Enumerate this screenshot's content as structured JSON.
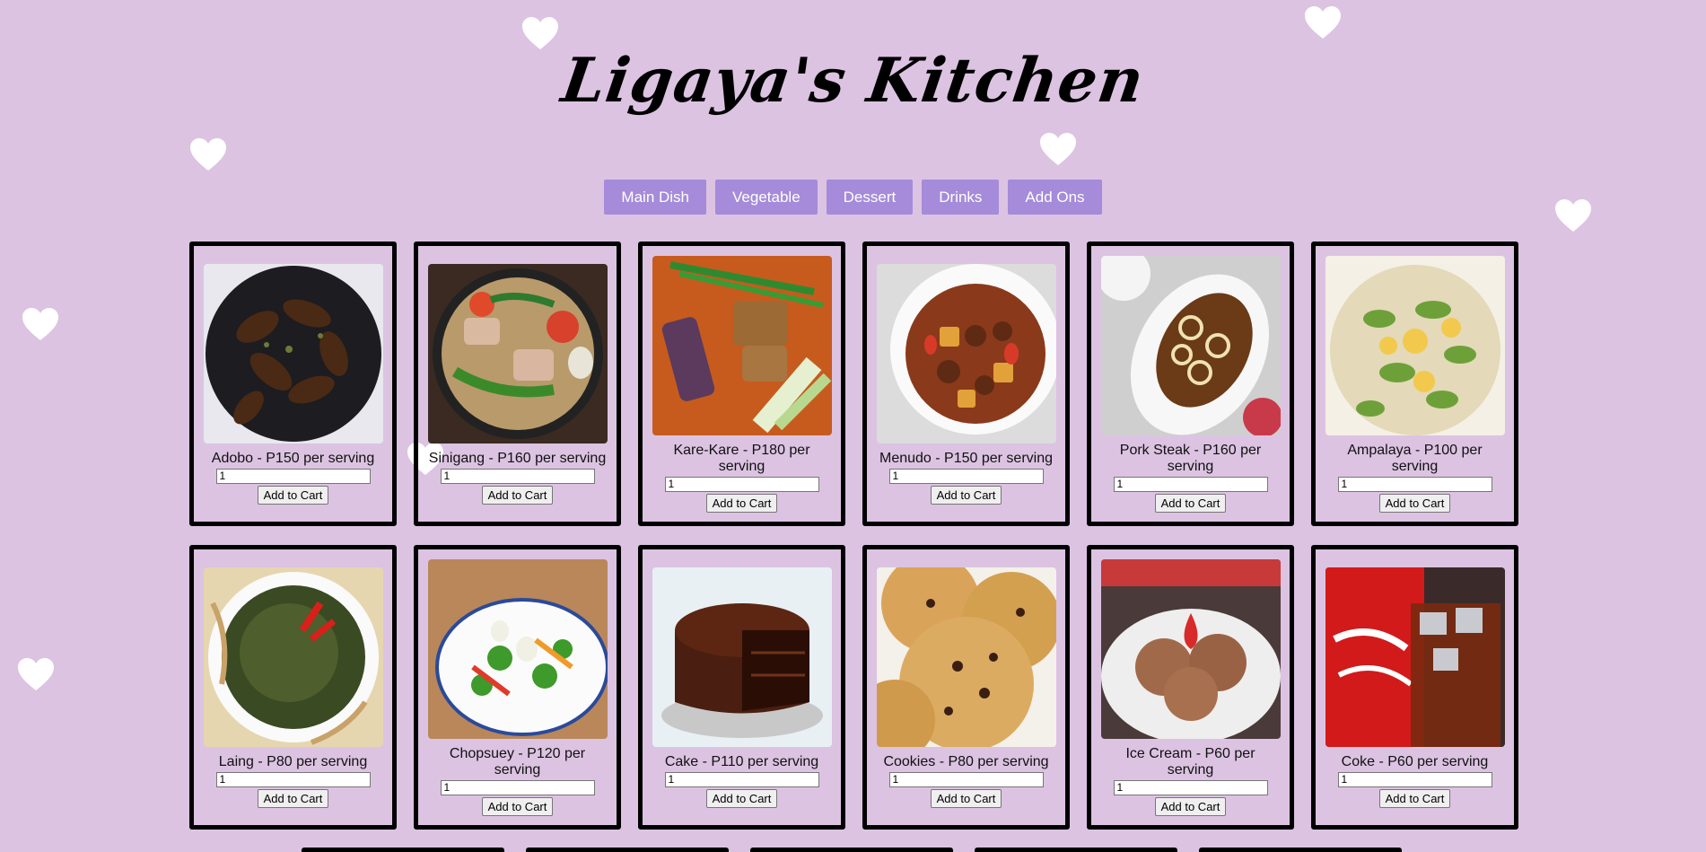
{
  "page": {
    "title": "Ligaya's Kitchen"
  },
  "nav": [
    {
      "label": "Main Dish"
    },
    {
      "label": "Vegetable"
    },
    {
      "label": "Dessert"
    },
    {
      "label": "Drinks"
    },
    {
      "label": "Add Ons"
    }
  ],
  "colors": {
    "background": "#dcc3e2",
    "nav_button": "#a58bd9",
    "card_border": "#000000",
    "heart": "#ffffff"
  },
  "menu": [
    {
      "name": "adobo",
      "label": "Adobo - P150 per serving",
      "qty": "1",
      "button": "Add to Cart",
      "image": "adobo-photo"
    },
    {
      "name": "sinigang",
      "label": "Sinigang - P160 per serving",
      "qty": "1",
      "button": "Add to Cart",
      "image": "sinigang-photo"
    },
    {
      "name": "kare-kare",
      "label": "Kare-Kare - P180 per serving",
      "qty": "1",
      "button": "Add to Cart",
      "image": "kare-kare-photo"
    },
    {
      "name": "menudo",
      "label": "Menudo - P150 per serving",
      "qty": "1",
      "button": "Add to Cart",
      "image": "menudo-photo"
    },
    {
      "name": "pork-steak",
      "label": "Pork Steak - P160 per serving",
      "qty": "1",
      "button": "Add to Cart",
      "image": "pork-steak-photo"
    },
    {
      "name": "ampalaya",
      "label": "Ampalaya - P100 per serving",
      "qty": "1",
      "button": "Add to Cart",
      "image": "ampalaya-photo"
    },
    {
      "name": "laing",
      "label": "Laing - P80 per serving",
      "qty": "1",
      "button": "Add to Cart",
      "image": "laing-photo"
    },
    {
      "name": "chopsuey",
      "label": "Chopsuey - P120 per serving",
      "qty": "1",
      "button": "Add to Cart",
      "image": "chopsuey-photo"
    },
    {
      "name": "cake",
      "label": "Cake - P110 per serving",
      "qty": "1",
      "button": "Add to Cart",
      "image": "chocolate-cake-photo"
    },
    {
      "name": "cookies",
      "label": "Cookies - P80 per serving",
      "qty": "1",
      "button": "Add to Cart",
      "image": "cookies-photo"
    },
    {
      "name": "ice-cream",
      "label": "Ice Cream - P60 per serving",
      "qty": "1",
      "button": "Add to Cart",
      "image": "ice-cream-photo"
    },
    {
      "name": "coke",
      "label": "Coke - P60 per serving",
      "qty": "1",
      "button": "Add to Cart",
      "image": "coke-photo"
    }
  ]
}
